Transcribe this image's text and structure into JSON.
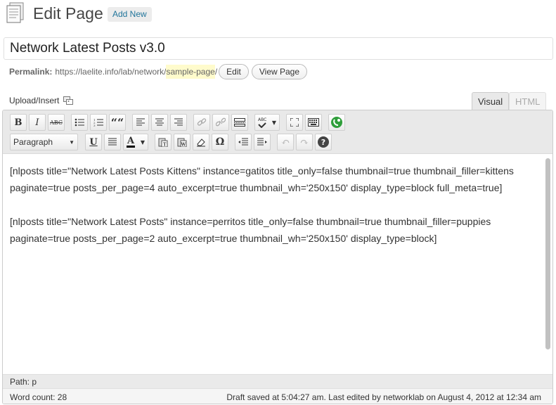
{
  "header": {
    "title": "Edit Page",
    "add_new_label": "Add New"
  },
  "post_title": {
    "value": "Network Latest Posts v3.0"
  },
  "permalink": {
    "label": "Permalink:",
    "base": "https://laelite.info/lab/network/",
    "slug": "sample-page",
    "suffix": "/",
    "edit_label": "Edit",
    "view_label": "View Page"
  },
  "media": {
    "upload_label": "Upload/Insert"
  },
  "tabs": {
    "visual": "Visual",
    "html": "HTML"
  },
  "toolbar": {
    "row1": [
      "bold",
      "italic",
      "strikethrough",
      "bullet-list",
      "numbered-list",
      "blockquote",
      "align-left",
      "align-center",
      "align-right",
      "link",
      "unlink",
      "more",
      "spellcheck",
      "fullscreen",
      "kitchen-sink",
      "plugin"
    ],
    "format_select": "Paragraph",
    "row2": [
      "underline",
      "justify",
      "text-color",
      "paste-text",
      "paste-word",
      "remove-format",
      "special-character",
      "outdent",
      "indent",
      "undo",
      "redo",
      "help"
    ],
    "glyphs": {
      "bold": "B",
      "italic": "I",
      "strike": "ABC",
      "blockquote": "““",
      "underline": "U",
      "color": "A",
      "omega": "Ω",
      "undo": "↶",
      "redo": "↷",
      "help": "?",
      "spell": "ABC"
    }
  },
  "content": {
    "paragraphs": [
      "[nlposts title=\"Network Latest Posts Kittens\" instance=gatitos title_only=false thumbnail=true thumbnail_filler=kittens paginate=true posts_per_page=4 auto_excerpt=true thumbnail_wh='250x150' display_type=block full_meta=true]",
      "[nlposts title=\"Network Latest Posts\" instance=perritos title_only=false thumbnail=true thumbnail_filler=puppies paginate=true posts_per_page=2 auto_excerpt=true thumbnail_wh='250x150' display_type=block]"
    ]
  },
  "path": {
    "text": "Path: p"
  },
  "status": {
    "word_count": "Word count: 28",
    "draft": "Draft saved at 5:04:27 am. Last edited by networklab on August 4, 2012 at 12:34 am"
  },
  "colors": {
    "link": "#21759b",
    "slug_highlight": "#fffbcc",
    "toolbar_bg": "#e9e9e9"
  }
}
